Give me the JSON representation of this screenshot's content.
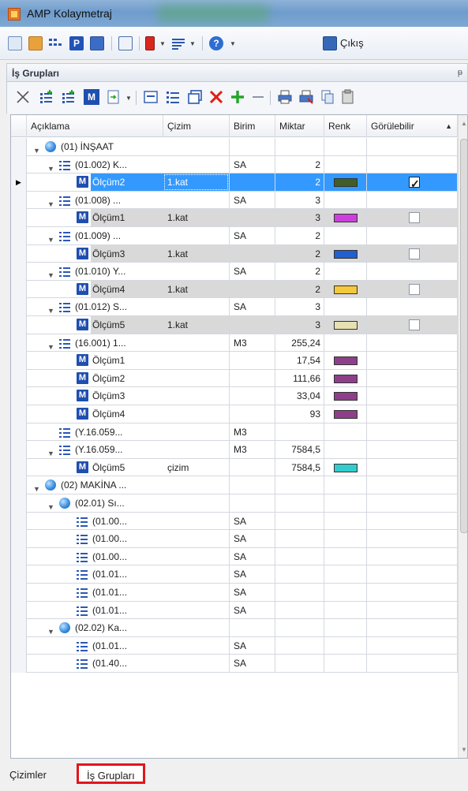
{
  "window": {
    "title": "AMP Kolaymetraj"
  },
  "toolbar": {
    "exit_label": "Çıkış"
  },
  "panel": {
    "title": "İş Grupları",
    "pin": "ᵽ"
  },
  "grid": {
    "columns": [
      "Açıklama",
      "Çizim",
      "Birim",
      "Miktar",
      "Renk",
      "Görülebilir"
    ],
    "rows": [
      {
        "level": 0,
        "icon": "globe",
        "expanded": true,
        "text": "(01) İNŞAAT",
        "cizim": "",
        "birim": "",
        "miktar": "",
        "renk": "",
        "gorulebilir": ""
      },
      {
        "level": 1,
        "icon": "list",
        "expanded": true,
        "text": "(01.002) K...",
        "cizim": "",
        "birim": "SA",
        "miktar": "2",
        "renk": "",
        "gorulebilir": ""
      },
      {
        "level": 2,
        "icon": "m",
        "text": "Ölçüm2",
        "cizim": "1.kat",
        "birim": "",
        "miktar": "2",
        "renk": "#3f5f26",
        "gorulebilir": "checked",
        "selected": true
      },
      {
        "level": 1,
        "icon": "list",
        "expanded": true,
        "text": "(01.008) ...",
        "cizim": "",
        "birim": "SA",
        "miktar": "3",
        "renk": "",
        "gorulebilir": ""
      },
      {
        "level": 2,
        "icon": "m",
        "text": "Ölçüm1",
        "cizim": "1.kat",
        "birim": "",
        "miktar": "3",
        "renk": "#cc3fdd",
        "gorulebilir": "unchecked",
        "grey": true
      },
      {
        "level": 1,
        "icon": "list",
        "expanded": true,
        "text": "(01.009) ...",
        "cizim": "",
        "birim": "SA",
        "miktar": "2",
        "renk": "",
        "gorulebilir": ""
      },
      {
        "level": 2,
        "icon": "m",
        "text": "Ölçüm3",
        "cizim": "1.kat",
        "birim": "",
        "miktar": "2",
        "renk": "#1f5fd0",
        "gorulebilir": "unchecked",
        "grey": true
      },
      {
        "level": 1,
        "icon": "list",
        "expanded": true,
        "text": "(01.010) Y...",
        "cizim": "",
        "birim": "SA",
        "miktar": "2",
        "renk": "",
        "gorulebilir": ""
      },
      {
        "level": 2,
        "icon": "m",
        "text": "Ölçüm4",
        "cizim": "1.kat",
        "birim": "",
        "miktar": "2",
        "renk": "#f3c83a",
        "gorulebilir": "unchecked",
        "grey": true
      },
      {
        "level": 1,
        "icon": "list",
        "expanded": true,
        "text": "(01.012) S...",
        "cizim": "",
        "birim": "SA",
        "miktar": "3",
        "renk": "",
        "gorulebilir": ""
      },
      {
        "level": 2,
        "icon": "m",
        "text": "Ölçüm5",
        "cizim": "1.kat",
        "birim": "",
        "miktar": "3",
        "renk": "#e6e0b2",
        "gorulebilir": "unchecked",
        "grey": true
      },
      {
        "level": 1,
        "icon": "list",
        "expanded": true,
        "text": "(16.001) 1...",
        "cizim": "",
        "birim": "M3",
        "miktar": "255,24",
        "renk": "",
        "gorulebilir": ""
      },
      {
        "level": 2,
        "icon": "m",
        "text": "Ölçüm1",
        "cizim": "",
        "birim": "",
        "miktar": "17,54",
        "renk": "#8e3f8a",
        "gorulebilir": ""
      },
      {
        "level": 2,
        "icon": "m",
        "text": "Ölçüm2",
        "cizim": "",
        "birim": "",
        "miktar": "111,66",
        "renk": "#8e3f8a",
        "gorulebilir": ""
      },
      {
        "level": 2,
        "icon": "m",
        "text": "Ölçüm3",
        "cizim": "",
        "birim": "",
        "miktar": "33,04",
        "renk": "#8e3f8a",
        "gorulebilir": ""
      },
      {
        "level": 2,
        "icon": "m",
        "text": "Ölçüm4",
        "cizim": "",
        "birim": "",
        "miktar": "93",
        "renk": "#8e3f8a",
        "gorulebilir": ""
      },
      {
        "level": 1,
        "icon": "list",
        "expanded": null,
        "text": "(Y.16.059...",
        "cizim": "",
        "birim": "M3",
        "miktar": "",
        "renk": "",
        "gorulebilir": ""
      },
      {
        "level": 1,
        "icon": "list",
        "expanded": true,
        "text": "(Y.16.059...",
        "cizim": "",
        "birim": "M3",
        "miktar": "7584,5",
        "renk": "",
        "gorulebilir": ""
      },
      {
        "level": 2,
        "icon": "m",
        "text": "Ölçüm5",
        "cizim": "çizim",
        "birim": "",
        "miktar": "7584,5",
        "renk": "#33cccc",
        "gorulebilir": ""
      },
      {
        "level": 0,
        "icon": "globe",
        "expanded": true,
        "text": "(02) MAKİNA ...",
        "cizim": "",
        "birim": "",
        "miktar": "",
        "renk": "",
        "gorulebilir": ""
      },
      {
        "level": 1,
        "icon": "globe",
        "expanded": true,
        "text": "(02.01) Sı...",
        "cizim": "",
        "birim": "",
        "miktar": "",
        "renk": "",
        "gorulebilir": ""
      },
      {
        "level": 2,
        "icon": "list",
        "text": "(01.00...",
        "cizim": "",
        "birim": "SA",
        "miktar": "",
        "renk": "",
        "gorulebilir": ""
      },
      {
        "level": 2,
        "icon": "list",
        "text": "(01.00...",
        "cizim": "",
        "birim": "SA",
        "miktar": "",
        "renk": "",
        "gorulebilir": ""
      },
      {
        "level": 2,
        "icon": "list",
        "text": "(01.00...",
        "cizim": "",
        "birim": "SA",
        "miktar": "",
        "renk": "",
        "gorulebilir": ""
      },
      {
        "level": 2,
        "icon": "list",
        "text": "(01.01...",
        "cizim": "",
        "birim": "SA",
        "miktar": "",
        "renk": "",
        "gorulebilir": ""
      },
      {
        "level": 2,
        "icon": "list",
        "text": "(01.01...",
        "cizim": "",
        "birim": "SA",
        "miktar": "",
        "renk": "",
        "gorulebilir": ""
      },
      {
        "level": 2,
        "icon": "list",
        "text": "(01.01...",
        "cizim": "",
        "birim": "SA",
        "miktar": "",
        "renk": "",
        "gorulebilir": ""
      },
      {
        "level": 1,
        "icon": "globe",
        "expanded": true,
        "text": "(02.02) Ka...",
        "cizim": "",
        "birim": "",
        "miktar": "",
        "renk": "",
        "gorulebilir": ""
      },
      {
        "level": 2,
        "icon": "list",
        "text": "(01.01...",
        "cizim": "",
        "birim": "SA",
        "miktar": "",
        "renk": "",
        "gorulebilir": ""
      },
      {
        "level": 2,
        "icon": "list",
        "text": "(01.40...",
        "cizim": "",
        "birim": "SA",
        "miktar": "",
        "renk": "",
        "gorulebilir": ""
      }
    ]
  },
  "tabs": [
    {
      "label": "Çizimler",
      "active": false
    },
    {
      "label": "İş Grupları",
      "active": true
    }
  ],
  "colors": {
    "selection": "#3399ff",
    "highlight_border": "#e0161b",
    "grey_row": "#d9d9d9"
  }
}
